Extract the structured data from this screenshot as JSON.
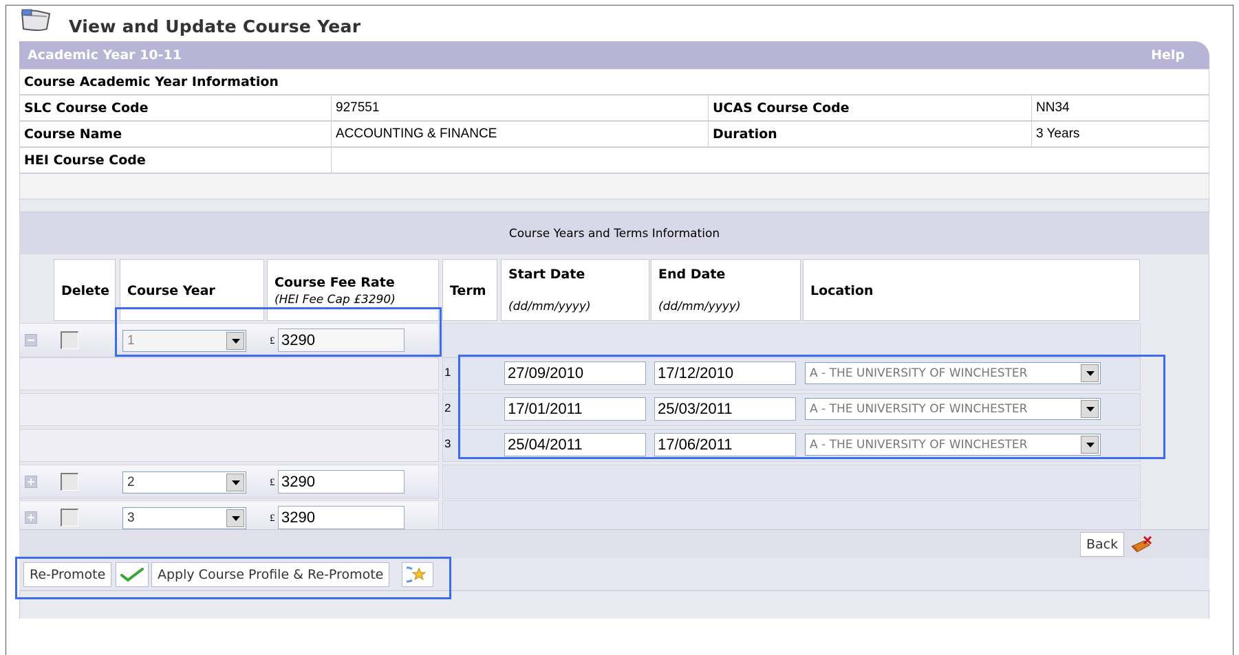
{
  "page": {
    "title": "View and Update Course Year",
    "academic_year": "Academic Year 10-11",
    "help_label": "Help"
  },
  "course_info": {
    "heading": "Course Academic Year Information",
    "slc_label": "SLC Course Code",
    "slc_value": "927551",
    "ucas_label": "UCAS Course Code",
    "ucas_value": "NN34",
    "name_label": "Course Name",
    "name_value": "ACCOUNTING & FINANCE",
    "duration_label": "Duration",
    "duration_value": "3 Years",
    "hei_label": "HEI Course Code",
    "hei_value": ""
  },
  "years_section": {
    "title": "Course Years and Terms Information",
    "headers": {
      "delete": "Delete",
      "course_year": "Course Year",
      "fee_rate": "Course Fee Rate",
      "fee_cap": "(HEI Fee Cap £3290)",
      "term": "Term",
      "start_date": "Start Date",
      "end_date": "End Date",
      "date_format": "(dd/mm/yyyy)",
      "location": "Location"
    },
    "currency_symbol": "£",
    "years": [
      {
        "year": "1",
        "fee": "3290",
        "expanded": true
      },
      {
        "year": "2",
        "fee": "3290",
        "expanded": false
      },
      {
        "year": "3",
        "fee": "3290",
        "expanded": false
      }
    ],
    "terms": [
      {
        "term": "1",
        "start": "27/09/2010",
        "end": "17/12/2010",
        "location": "A - THE UNIVERSITY OF WINCHESTER"
      },
      {
        "term": "2",
        "start": "17/01/2011",
        "end": "25/03/2011",
        "location": "A - THE UNIVERSITY OF WINCHESTER"
      },
      {
        "term": "3",
        "start": "25/04/2011",
        "end": "17/06/2011",
        "location": "A - THE UNIVERSITY OF WINCHESTER"
      }
    ]
  },
  "actions": {
    "back_label": "Back",
    "repromote_label": "Re-Promote",
    "apply_profile_label": "Apply Course Profile & Re-Promote"
  },
  "colors": {
    "header_band": "#b8b4d6",
    "highlight": "#3b6cf0"
  }
}
